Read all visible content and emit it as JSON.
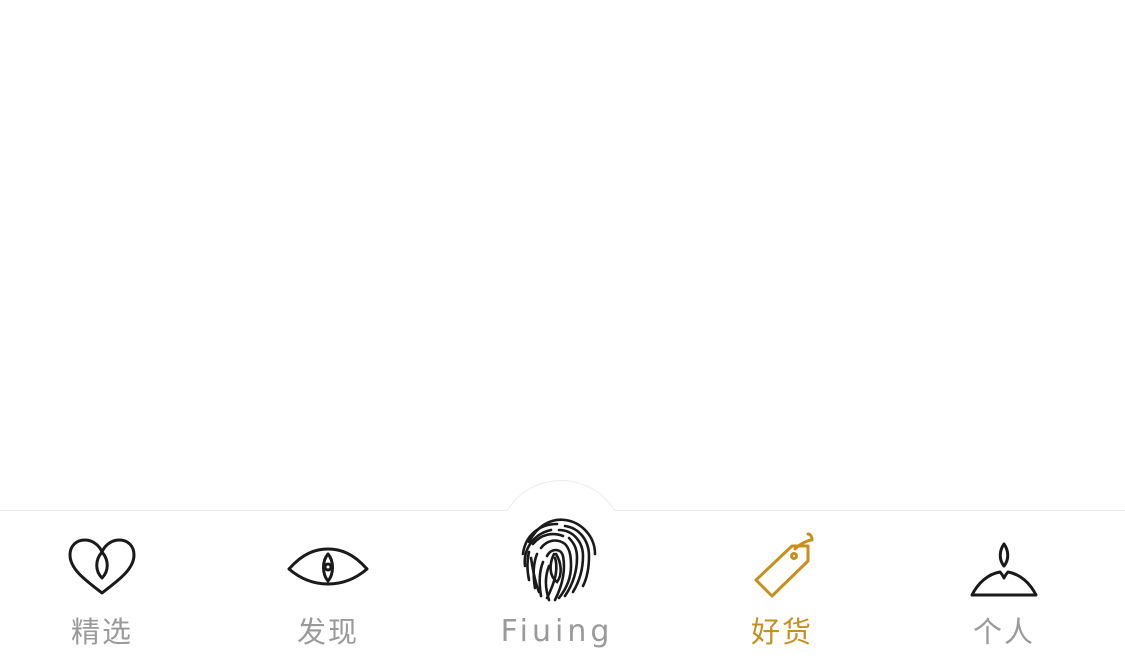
{
  "tabbar": {
    "active_color": "#c5901d",
    "inactive_color": "#9a9a9a",
    "items": [
      {
        "label": "精选",
        "icon": "heart-icon",
        "active": false
      },
      {
        "label": "发现",
        "icon": "eye-icon",
        "active": false
      },
      {
        "label": "Fiuing",
        "icon": "fingerprint-icon",
        "active": false
      },
      {
        "label": "好货",
        "icon": "price-tag-icon",
        "active": true
      },
      {
        "label": "个人",
        "icon": "person-icon",
        "active": false
      }
    ]
  }
}
